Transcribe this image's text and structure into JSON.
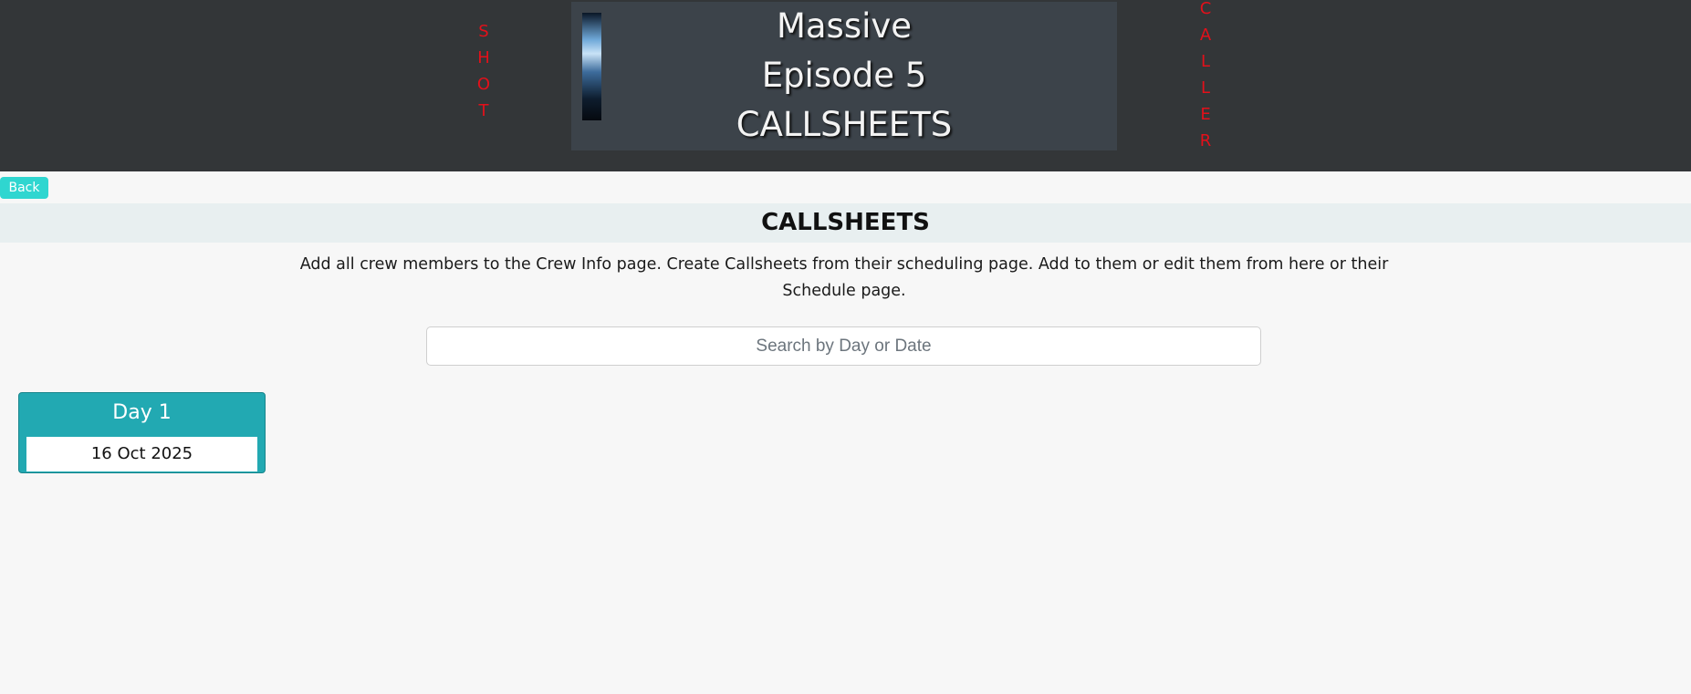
{
  "header": {
    "left_word_letters": [
      "S",
      "H",
      "O",
      "T"
    ],
    "right_word_letters": [
      "C",
      "A",
      "L",
      "L",
      "E",
      "R"
    ],
    "project_title": "Massive",
    "episode": "Episode 5",
    "page_heading": "CALLSHEETS"
  },
  "nav": {
    "back_label": "Back"
  },
  "main": {
    "section_title": "CALLSHEETS",
    "instructions": "Add all crew members to the Crew Info page. Create Callsheets from their scheduling page. Add to them or edit them from here or their Schedule page.",
    "search_placeholder": "Search by Day or Date",
    "search_value": ""
  },
  "callsheets": [
    {
      "day_label": "Day 1",
      "date": "16 Oct 2025"
    }
  ],
  "colors": {
    "header_bg": "#333638",
    "accent_red": "#e3101a",
    "accent_teal": "#22a9b2",
    "back_button": "#2fd6d0"
  }
}
